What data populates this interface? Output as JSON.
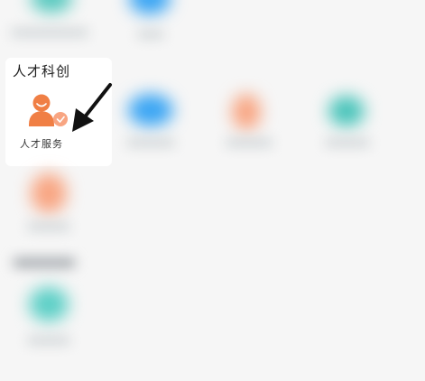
{
  "section": {
    "title": "人才科创",
    "tile_label": "人才服务"
  },
  "colors": {
    "orange": "#f07f45",
    "blue": "#3aa5f3",
    "teal": "#49c4ba",
    "peach": "#f8a582",
    "arrow": "#111111"
  },
  "icons": {
    "talent_service": "person-badge-icon",
    "pointer": "arrow-pointer-icon"
  }
}
